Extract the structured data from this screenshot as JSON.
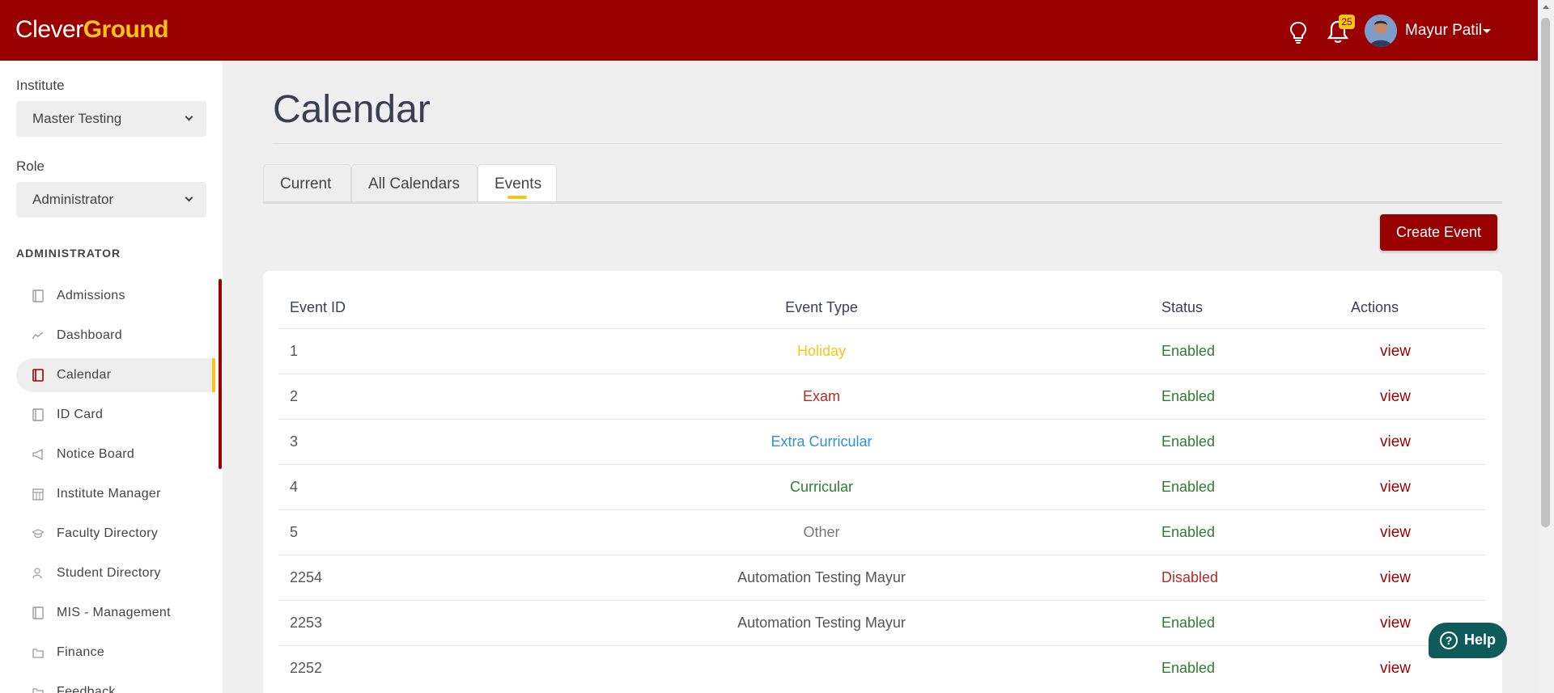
{
  "brand": {
    "part1": "Clever",
    "part2": "Ground"
  },
  "header": {
    "notifications_count": "25",
    "user_name": "Mayur Patil"
  },
  "sidebar": {
    "institute_label": "Institute",
    "institute_value": "Master Testing",
    "role_label": "Role",
    "role_value": "Administrator",
    "section_title": "ADMINISTRATOR",
    "items": [
      {
        "label": "Admissions",
        "icon": "book-icon"
      },
      {
        "label": "Dashboard",
        "icon": "trend-line-icon"
      },
      {
        "label": "Calendar",
        "icon": "book-icon"
      },
      {
        "label": "ID Card",
        "icon": "book-icon"
      },
      {
        "label": "Notice Board",
        "icon": "megaphone-icon"
      },
      {
        "label": "Institute Manager",
        "icon": "calendar-grid-icon"
      },
      {
        "label": "Faculty Directory",
        "icon": "graduation-cap-icon"
      },
      {
        "label": "Student Directory",
        "icon": "users-icon"
      },
      {
        "label": "MIS - Management",
        "icon": "book-icon"
      },
      {
        "label": "Finance",
        "icon": "folder-icon"
      },
      {
        "label": "Feedback",
        "icon": "folder-icon"
      }
    ],
    "active_item": "Calendar"
  },
  "main": {
    "title": "Calendar",
    "tabs": [
      {
        "label": "Current"
      },
      {
        "label": "All Calendars"
      },
      {
        "label": "Events"
      }
    ],
    "active_tab": "Events",
    "create_button": "Create Event",
    "table": {
      "headers": [
        "Event ID",
        "Event Type",
        "Status",
        "Actions"
      ],
      "rows": [
        {
          "id": "1",
          "type": "Holiday",
          "type_color": "#f5c518",
          "status": "Enabled",
          "action": "view"
        },
        {
          "id": "2",
          "type": "Exam",
          "type_color": "#b02a2a",
          "status": "Enabled",
          "action": "view"
        },
        {
          "id": "3",
          "type": "Extra Curricular",
          "type_color": "#2f8fd8",
          "status": "Enabled",
          "action": "view"
        },
        {
          "id": "4",
          "type": "Curricular",
          "type_color": "#2e7d32",
          "status": "Enabled",
          "action": "view"
        },
        {
          "id": "5",
          "type": "Other",
          "type_color": "#777777",
          "status": "Enabled",
          "action": "view"
        },
        {
          "id": "2254",
          "type": "Automation Testing Mayur",
          "type_color": "#555555",
          "status": "Disabled",
          "action": "view"
        },
        {
          "id": "2253",
          "type": "Automation Testing Mayur",
          "type_color": "#555555",
          "status": "Enabled",
          "action": "view"
        },
        {
          "id": "2252",
          "type": "",
          "type_color": "#555555",
          "status": "Enabled",
          "action": "view"
        }
      ]
    }
  },
  "help_button": "Help",
  "colors": {
    "brand_red": "#990000",
    "accent_yellow": "#f5c518",
    "status_enabled": "#2e7d32",
    "status_disabled": "#b02a2a"
  }
}
